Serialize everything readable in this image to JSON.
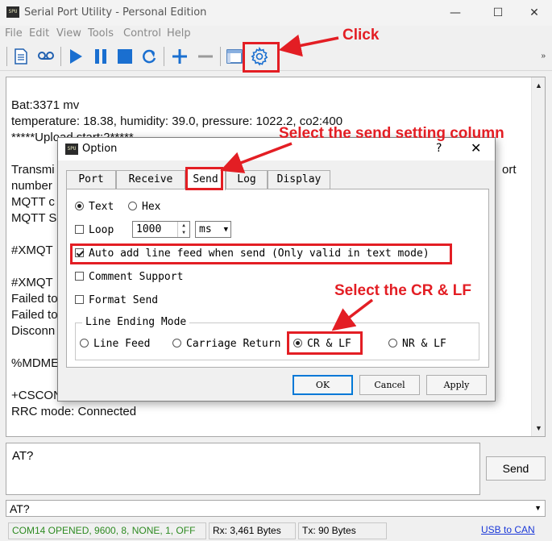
{
  "window": {
    "title": "Serial Port Utility - Personal Edition",
    "app_icon": "SPU",
    "minimize": "—",
    "maximize": "☐",
    "close": "✕"
  },
  "menu": [
    "File",
    "Edit",
    "View",
    "Tools",
    "Control",
    "Help"
  ],
  "toolbar": {
    "icons": [
      "document-icon",
      "recording-icon",
      "play-icon",
      "pause-icon",
      "stop-icon",
      "refresh-icon",
      "plus-icon",
      "minus-icon",
      "window-icon",
      "settings-gear-icon"
    ],
    "more": "»"
  },
  "terminal": {
    "lines": [
      "",
      "Bat:3371 mv",
      "temperature: 18.38, humidity: 39.0, pressure: 1022.2, co2:400",
      "*****Upload start:2*****",
      "",
      "Transmi",
      "number",
      "MQTT c",
      "MQTT S",
      "",
      "#XMQT",
      "",
      "#XMQT",
      "Failed to",
      "Failed to",
      "Disconn",
      "",
      "%MDME",
      "",
      "+CSCON",
      "RRC mode: Connected"
    ],
    "right_fragment": "ort"
  },
  "send_area": {
    "text": "AT?",
    "send_label": "Send"
  },
  "history": {
    "value": "AT?"
  },
  "statusbar": {
    "port_status": "COM14 OPENED, 9600, 8, NONE, 1, OFF",
    "rx": "Rx: 3,461 Bytes",
    "tx": "Tx: 90 Bytes",
    "link": "USB to CAN",
    "port_status_color": "#2e8b22"
  },
  "dialog": {
    "title": "Option",
    "help": "?",
    "close": "✕",
    "tabs": [
      "Port",
      "Receive",
      "Send",
      "Log",
      "Display"
    ],
    "active_tab": "Send",
    "mode": {
      "text_label": "Text",
      "hex_label": "Hex",
      "selected": "Text"
    },
    "loop": {
      "label": "Loop",
      "checked": false,
      "interval": "1000",
      "unit": "ms"
    },
    "auto_line_feed": {
      "label": "Auto add line feed when send (Only valid in text mode)",
      "checked": true
    },
    "comment_support": {
      "label": "Comment Support",
      "checked": false
    },
    "format_send": {
      "label": "Format Send",
      "checked": false
    },
    "line_ending": {
      "legend": "Line Ending Mode",
      "options": [
        "Line Feed",
        "Carriage Return",
        "CR & LF",
        "NR & LF"
      ],
      "selected": "CR & LF"
    },
    "buttons": {
      "ok": "OK",
      "cancel": "Cancel",
      "apply": "Apply"
    }
  },
  "annotations": {
    "click": "Click",
    "select_send": "Select the send setting column",
    "select_crlf": "Select the CR & LF",
    "color": "#e31e24"
  }
}
